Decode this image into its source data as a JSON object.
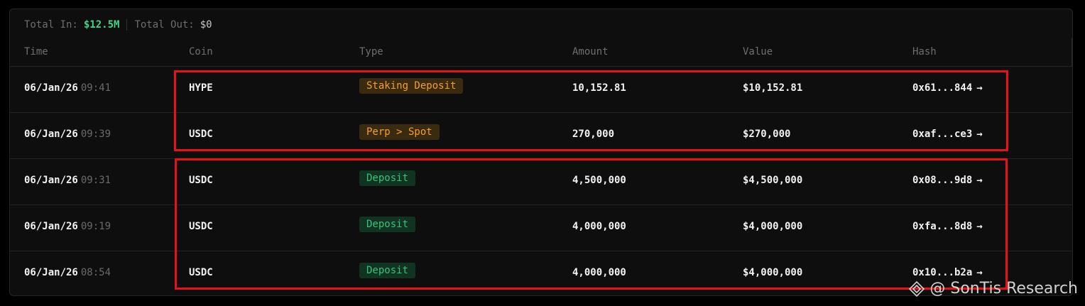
{
  "summary": {
    "total_in_label": "Total In:",
    "total_in_value": "$12.5M",
    "total_out_label": "Total Out:",
    "total_out_value": "$0"
  },
  "columns": {
    "time": "Time",
    "coin": "Coin",
    "type": "Type",
    "amount": "Amount",
    "value": "Value",
    "hash": "Hash"
  },
  "rows": [
    {
      "date": "06/Jan/26",
      "time": "09:41",
      "coin": "HYPE",
      "type": "Staking Deposit",
      "type_color": "orange",
      "amount": "10,152.81",
      "value": "$10,152.81",
      "hash": "0x61...844",
      "arrow": "→"
    },
    {
      "date": "06/Jan/26",
      "time": "09:39",
      "coin": "USDC",
      "type": "Perp > Spot",
      "type_color": "orange",
      "amount": "270,000",
      "value": "$270,000",
      "hash": "0xaf...ce3",
      "arrow": "→"
    },
    {
      "date": "06/Jan/26",
      "time": "09:31",
      "coin": "USDC",
      "type": "Deposit",
      "type_color": "green",
      "amount": "4,500,000",
      "value": "$4,500,000",
      "hash": "0x08...9d8",
      "arrow": "→"
    },
    {
      "date": "06/Jan/26",
      "time": "09:19",
      "coin": "USDC",
      "type": "Deposit",
      "type_color": "green",
      "amount": "4,000,000",
      "value": "$4,000,000",
      "hash": "0xfa...8d8",
      "arrow": "→"
    },
    {
      "date": "06/Jan/26",
      "time": "08:54",
      "coin": "USDC",
      "type": "Deposit",
      "type_color": "green",
      "amount": "4,000,000",
      "value": "$4,000,000",
      "hash": "0x10...b2a",
      "arrow": "→"
    }
  ],
  "colors": {
    "accent_green": "#3fd68a",
    "badge_orange": "#f59e2f",
    "badge_green": "#35c27a",
    "highlight_red": "#e8101a"
  },
  "watermark": {
    "text": "@ SonTis Research",
    "icon": "diamond-logo-icon"
  }
}
